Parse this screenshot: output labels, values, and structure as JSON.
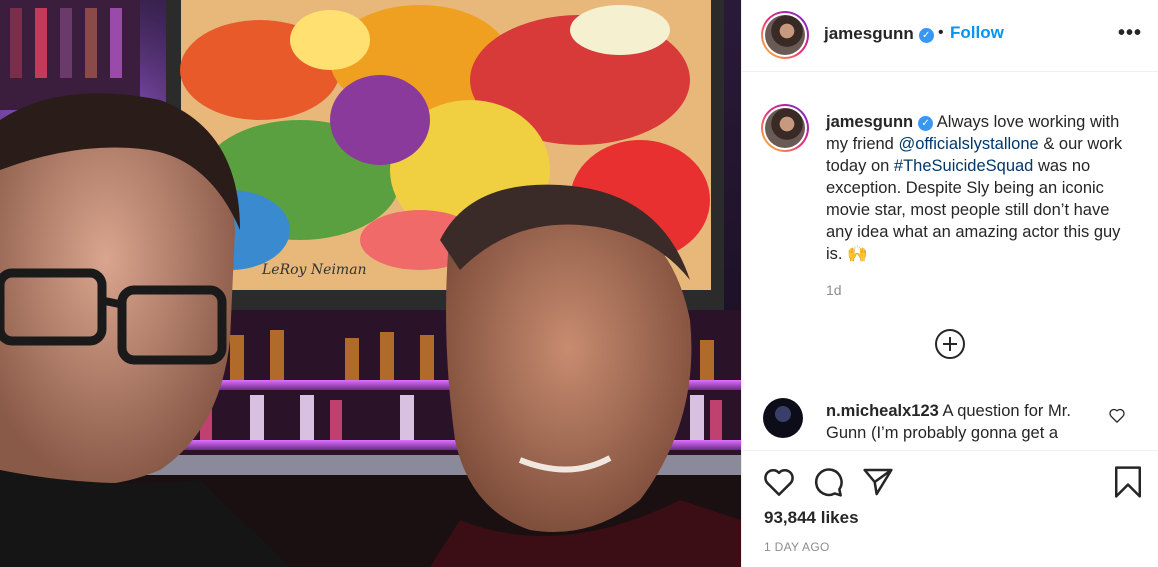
{
  "header": {
    "username": "jamesgunn",
    "separator": "•",
    "follow_label": "Follow",
    "more_label": "•••"
  },
  "caption": {
    "username": "jamesgunn",
    "text_1": "Always love working with my friend",
    "mention": "@officialslystallone",
    "text_2": "& our work today on",
    "hashtag": "#TheSuicideSquad",
    "text_3": "was no exception. Despite Sly being an iconic movie star, most people still don’t have any idea what an amazing actor this guy is.",
    "emoji": "🙌",
    "time": "1d"
  },
  "comment": {
    "username": "n.michealx123",
    "text": "A question for Mr. Gunn (I’m probably gonna get a"
  },
  "stats": {
    "likes": "93,844 likes",
    "date": "1 DAY AGO"
  },
  "photo": {
    "signature": "LeRoy Neiman"
  },
  "colors": {
    "accent": "#0095f6",
    "verified": "#3897f0",
    "mention": "#00376b",
    "muted": "#8e8e8e"
  },
  "icons": {
    "like": "heart-icon",
    "comment": "comment-icon",
    "share": "paper-plane-icon",
    "save": "bookmark-icon",
    "verified": "verified-badge-icon",
    "load_more": "plus-circle-icon"
  }
}
